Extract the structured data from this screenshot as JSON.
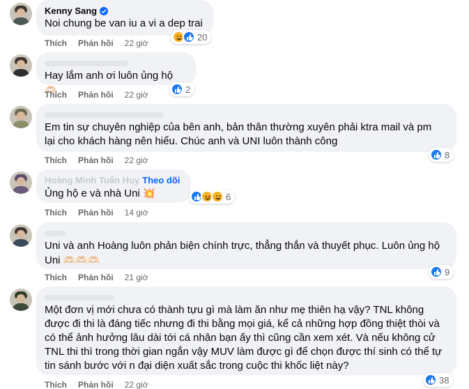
{
  "actions": {
    "like": "Thích",
    "reply": "Phản hồi"
  },
  "comments": [
    {
      "author": "Kenny Sang",
      "verified": true,
      "text": "Noi chung be van iu a vi a dep trai",
      "time": "22 giờ",
      "reactions": [
        "haha",
        "like"
      ],
      "count": "20"
    },
    {
      "author": "",
      "text": "Hay lắm anh ơi luôn ủng hộ",
      "emoji": "🫶🏻",
      "time": "22 giờ",
      "reactions": [
        "like"
      ],
      "count": "2"
    },
    {
      "author": "",
      "text": "Em tin sự chuyên nghiệp của bên anh, bản thân thường xuyên phải ktra mail và pm\nlại cho khách hàng nên hiểu. Chúc anh và UNI luôn thành công",
      "time": "22 giờ",
      "reactions": [
        "like"
      ],
      "count": "8"
    },
    {
      "author": "Hoàng Minh Tuấn Huy",
      "follow": "Theo dõi",
      "text": "Ủng hộ e và nhà Uni",
      "emoji": "💥",
      "time": "14 giờ",
      "reactions": [
        "like",
        "haha",
        "wow"
      ],
      "count": "6"
    },
    {
      "author": "",
      "text": "Uni và anh Hoàng luôn phản biện chính trực, thẳng thắn và thuyết phục. Luôn ủng hộ\nUni",
      "emoji": "🫶🏻🫶🏻🫶🏻",
      "time": "21 giờ",
      "reactions": [
        "like"
      ],
      "count": "9"
    },
    {
      "author": "",
      "text": "Một đơn vị mới chưa có thành tựu gì mà làm ăn như mẹ thiên hạ vậy? TNL không\nđược đi thi là đáng tiếc nhưng đi thi bằng mọi giá, kể cả những hợp đồng thiệt thòi và\ncó thể ảnh hưởng lâu dài tới cá nhân bạn ấy thì cũng cần xem xét. Và nếu không cử\nTNL thi thì trong thời gian ngắn vậy MUV làm được gì để chọn được thí sinh có thể tự\ntin sánh bước với n đại diện xuất sắc trong cuộc thi khốc liệt này?",
      "time": "22 giờ",
      "reactions": [
        "like"
      ],
      "count": "38"
    }
  ]
}
